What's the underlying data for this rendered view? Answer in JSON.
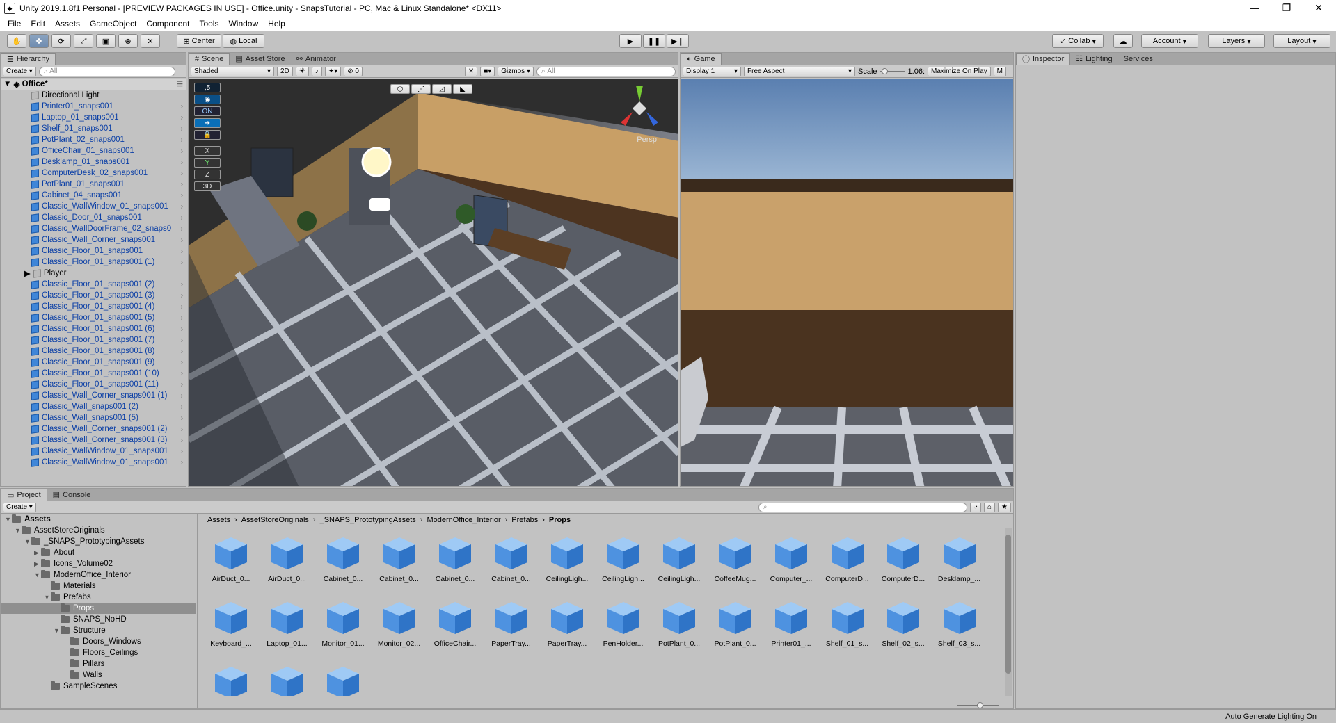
{
  "window": {
    "title": "Unity 2019.1.8f1 Personal - [PREVIEW PACKAGES IN USE] - Office.unity - SnapsTutorial - PC, Mac & Linux Standalone* <DX11>",
    "minimize": "—",
    "maximize": "❐",
    "close": "✕"
  },
  "menu": [
    "File",
    "Edit",
    "Assets",
    "GameObject",
    "Component",
    "Tools",
    "Window",
    "Help"
  ],
  "toolbar": {
    "pivot": "Center",
    "space": "Local",
    "collab": "Collab",
    "account": "Account",
    "layers": "Layers",
    "layout": "Layout"
  },
  "hierarchy": {
    "tab": "Hierarchy",
    "create": "Create",
    "search_placeholder": "All",
    "scene": "Office*",
    "items": [
      "Directional Light",
      "Printer01_snaps001",
      "Laptop_01_snaps001",
      "Shelf_01_snaps001",
      "PotPlant_02_snaps001",
      "OfficeChair_01_snaps001",
      "Desklamp_01_snaps001",
      "ComputerDesk_02_snaps001",
      "PotPlant_01_snaps001",
      "Cabinet_04_snaps001",
      "Classic_WallWindow_01_snaps001",
      "Classic_Door_01_snaps001",
      "Classic_WallDoorFrame_02_snaps0",
      "Classic_Wall_Corner_snaps001",
      "Classic_Floor_01_snaps001",
      "Classic_Floor_01_snaps001 (1)",
      "Player",
      "Classic_Floor_01_snaps001 (2)",
      "Classic_Floor_01_snaps001 (3)",
      "Classic_Floor_01_snaps001 (4)",
      "Classic_Floor_01_snaps001 (5)",
      "Classic_Floor_01_snaps001 (6)",
      "Classic_Floor_01_snaps001 (7)",
      "Classic_Floor_01_snaps001 (8)",
      "Classic_Floor_01_snaps001 (9)",
      "Classic_Floor_01_snaps001 (10)",
      "Classic_Floor_01_snaps001 (11)",
      "Classic_Wall_Corner_snaps001 (1)",
      "Classic_Wall_snaps001 (2)",
      "Classic_Wall_snaps001 (5)",
      "Classic_Wall_Corner_snaps001 (2)",
      "Classic_Wall_Corner_snaps001 (3)",
      "Classic_WallWindow_01_snaps001",
      "Classic_WallWindow_01_snaps001"
    ]
  },
  "scene": {
    "tab_scene": "Scene",
    "tab_store": "Asset Store",
    "tab_animator": "Animator",
    "shading": "Shaded",
    "mode2d": "2D",
    "gizmos": "Gizmos",
    "search_placeholder": "All",
    "fx_count": "0",
    "persp": "Persp",
    "snap_value": ",5",
    "snap_on": "ON",
    "axis_x": "X",
    "axis_y": "Y",
    "axis_z": "Z",
    "mode3d": "3D"
  },
  "game": {
    "tab": "Game",
    "display": "Display 1",
    "aspect": "Free Aspect",
    "scale_label": "Scale",
    "scale_value": "1.06:",
    "maximize": "Maximize On Play",
    "mute": "M"
  },
  "inspector": {
    "tab": "Inspector",
    "lighting": "Lighting",
    "services": "Services"
  },
  "project": {
    "tab": "Project",
    "console": "Console",
    "create": "Create",
    "breadcrumb": [
      "Assets",
      "AssetStoreOriginals",
      "_SNAPS_PrototypingAssets",
      "ModernOffice_Interior",
      "Prefabs",
      "Props"
    ],
    "tree": [
      {
        "label": "Assets",
        "depth": 0,
        "bold": true
      },
      {
        "label": "AssetStoreOriginals",
        "depth": 1
      },
      {
        "label": "_SNAPS_PrototypingAssets",
        "depth": 2
      },
      {
        "label": "About",
        "depth": 3
      },
      {
        "label": "Icons_Volume02",
        "depth": 3
      },
      {
        "label": "ModernOffice_Interior",
        "depth": 3
      },
      {
        "label": "Materials",
        "depth": 4
      },
      {
        "label": "Prefabs",
        "depth": 4
      },
      {
        "label": "Props",
        "depth": 5,
        "selected": true
      },
      {
        "label": "SNAPS_NoHD",
        "depth": 5
      },
      {
        "label": "Structure",
        "depth": 5
      },
      {
        "label": "Doors_Windows",
        "depth": 6
      },
      {
        "label": "Floors_Ceilings",
        "depth": 6
      },
      {
        "label": "Pillars",
        "depth": 6
      },
      {
        "label": "Walls",
        "depth": 6
      },
      {
        "label": "SampleScenes",
        "depth": 4
      }
    ],
    "assets": [
      "AirDuct_0...",
      "AirDuct_0...",
      "Cabinet_0...",
      "Cabinet_0...",
      "Cabinet_0...",
      "Cabinet_0...",
      "CeilingLigh...",
      "CeilingLigh...",
      "CeilingLigh...",
      "CoffeeMug...",
      "Computer_...",
      "ComputerD...",
      "ComputerD...",
      "Desklamp_...",
      "Keyboard_...",
      "Laptop_01...",
      "Monitor_01...",
      "Monitor_02...",
      "OfficeChair...",
      "PaperTray...",
      "PaperTray...",
      "PenHolder...",
      "PotPlant_0...",
      "PotPlant_0...",
      "Printer01_...",
      "Shelf_01_s...",
      "Shelf_02_s...",
      "Shelf_03_s...",
      "",
      "",
      ""
    ]
  },
  "status": {
    "right": "Auto Generate Lighting On"
  },
  "colors": {
    "accent": "#3f86d8",
    "selection": "#8f8f8f",
    "sky_top": "#5a7fb0",
    "wall": "#c9a16b"
  }
}
